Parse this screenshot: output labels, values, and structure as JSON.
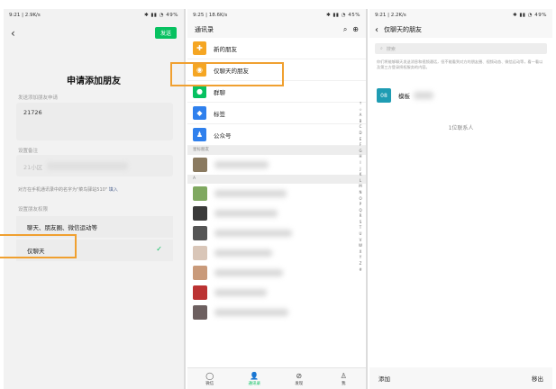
{
  "panel1": {
    "status_left": "9:21 | 2.9K/s",
    "status_right": "49%",
    "send_label": "发送",
    "title": "申请添加朋友",
    "request_label": "发送添加朋友申请",
    "request_value": "21726",
    "remark_label": "设置备注",
    "remark_value": "21小区",
    "hint_text": "对方在手机通讯录中的名字为\"菜鸟驿站510\"",
    "hint_link": "填入",
    "permission_label": "设置朋友权限",
    "option_all": "聊天、朋友圈、微信运动等",
    "option_chat_only": "仅聊天"
  },
  "panel2": {
    "status_left": "9:25 | 18.6K/s",
    "status_right": "45%",
    "title": "通讯录",
    "rows": [
      {
        "label": "新的朋友",
        "icon": "person-add-icon",
        "color": "#f5a623"
      },
      {
        "label": "仅聊天的朋友",
        "icon": "chat-only-icon",
        "color": "#f5a623"
      },
      {
        "label": "群聊",
        "icon": "group-icon",
        "color": "#07c160"
      },
      {
        "label": "标签",
        "icon": "tag-icon",
        "color": "#2f80ed"
      },
      {
        "label": "公众号",
        "icon": "official-account-icon",
        "color": "#2f80ed"
      }
    ],
    "starred_header": "星标朋友",
    "section_a": "A",
    "alphabet": [
      "↑",
      "☆",
      "A",
      "B",
      "C",
      "D",
      "E",
      "F",
      "G",
      "H",
      "I",
      "J",
      "K",
      "L",
      "M",
      "N",
      "O",
      "P",
      "Q",
      "R",
      "S",
      "T",
      "U",
      "V",
      "W",
      "X",
      "Y",
      "Z",
      "#"
    ],
    "tabs": [
      {
        "label": "微信",
        "icon": "chat-bubble-icon"
      },
      {
        "label": "通讯录",
        "icon": "contacts-icon"
      },
      {
        "label": "发现",
        "icon": "compass-icon"
      },
      {
        "label": "我",
        "icon": "profile-icon"
      }
    ]
  },
  "panel3": {
    "status_left": "9:21 | 2.2K/s",
    "status_right": "49%",
    "title": "仅聊天的朋友",
    "search_placeholder": "搜索",
    "description": "你们将能够聊天发送消息和视频通话，但不能看到对方的朋友圈、视频动态、微信运动等，看一看以及第三方登录授权服务的内容。",
    "contact_name": "模板",
    "contact_avatar_text": "08",
    "count_text": "1位联系人",
    "add_label": "添加",
    "remove_label": "移出"
  },
  "colors": {
    "wechat_green": "#07c160",
    "highlight_orange": "#f0a030"
  }
}
